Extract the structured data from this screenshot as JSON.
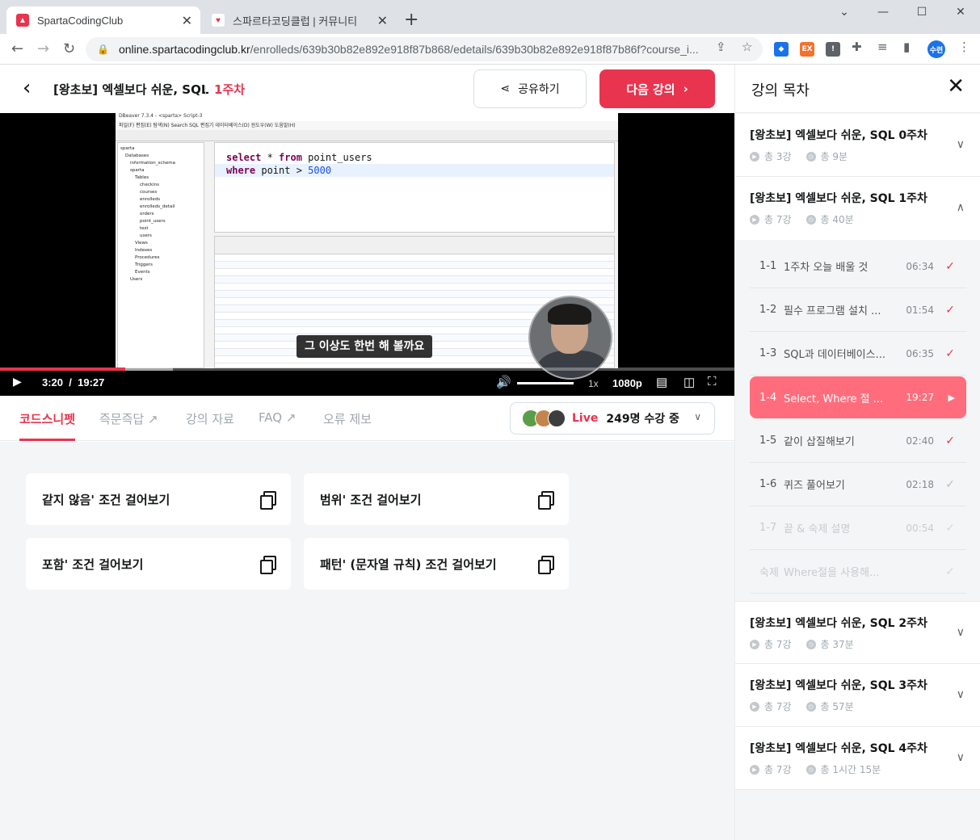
{
  "browser": {
    "tabs": [
      {
        "title": "SpartaCodingClub",
        "active": true
      },
      {
        "title": "스파르타코딩클럽 | 커뮤니티",
        "active": false
      }
    ],
    "url_host": "online.spartacodingclub.kr",
    "url_path": "/enrolleds/639b30b82e892e918f87b868/edetails/639b30b82e892e918f87b86f?course_i...",
    "profile_label": "수련"
  },
  "header": {
    "course_title": "[왕초보] 엑셀보다 쉬운, SQL",
    "week_label": "1주차",
    "share_label": "공유하기",
    "next_label": "다음 강의"
  },
  "video": {
    "sql_line1": [
      "select",
      " * ",
      "from",
      " point_users"
    ],
    "sql_line2": [
      "where",
      " point ",
      "> ",
      "5000"
    ],
    "caption": "그 이상도 한번 해 볼까요",
    "current_time": "3:20",
    "separator": "/",
    "duration": "19:27",
    "progress": 0.171,
    "buffered": 0.235,
    "speed": "1x",
    "quality": "1080p",
    "db_title": "DBeaver 7.3.4 - <sparta> Script-3",
    "db_menu": "파일(F)  편집(E)  탐색(N)  Search  SQL 편집기  데이터베이스(D)  윈도우(W)  도움말(H)",
    "db_tree": [
      "sparta",
      "Databases",
      "information_schema",
      "sparta",
      "Tables",
      "checkins",
      "courses",
      "enrolleds",
      "enrolleds_detail",
      "orders",
      "point_users",
      "test",
      "users",
      "Views",
      "Indexes",
      "Procedures",
      "Triggers",
      "Events",
      "Users"
    ]
  },
  "page_tabs": [
    {
      "label": "코드스니펫",
      "active": true
    },
    {
      "label": "즉문즉답",
      "active": false
    },
    {
      "label": "강의 자료",
      "active": false
    },
    {
      "label": "FAQ",
      "active": false
    },
    {
      "label": "오류 제보",
      "active": false
    }
  ],
  "live": {
    "tag": "Live",
    "count": "249명 수강 중"
  },
  "snippets": [
    "같지 않음' 조건 걸어보기",
    "범위' 조건 걸어보기",
    "포함' 조건 걸어보기",
    "패턴' (문자열 규칙) 조건 걸어보기"
  ],
  "sidebar": {
    "title": "강의 목차",
    "weeks": [
      {
        "title": "[왕초보] 엑셀보다 쉬운, SQL 0주차",
        "count": "총 3강",
        "time": "총 9분",
        "expanded": false
      },
      {
        "title": "[왕초보] 엑셀보다 쉬운, SQL 1주차",
        "count": "총 7강",
        "time": "총 40분",
        "expanded": true
      },
      {
        "title": "[왕초보] 엑셀보다 쉬운, SQL 2주차",
        "count": "총 7강",
        "time": "총 37분",
        "expanded": false
      },
      {
        "title": "[왕초보] 엑셀보다 쉬운, SQL 3주차",
        "count": "총 7강",
        "time": "총 57분",
        "expanded": false
      },
      {
        "title": "[왕초보] 엑셀보다 쉬운, SQL 4주차",
        "count": "총 7강",
        "time": "총 1시간 15분",
        "expanded": false
      }
    ],
    "lessons": [
      {
        "num": "1-1",
        "name": "1주차 오늘 배울 것",
        "duration": "06:34",
        "state": "done"
      },
      {
        "num": "1-2",
        "name": "필수 프로그램 설치 ...",
        "duration": "01:54",
        "state": "done"
      },
      {
        "num": "1-3",
        "name": "SQL과 데이터베이스...",
        "duration": "06:35",
        "state": "done"
      },
      {
        "num": "1-4",
        "name": "Select, Where 절 ...",
        "duration": "19:27",
        "state": "current"
      },
      {
        "num": "1-5",
        "name": "같이 삽질해보기",
        "duration": "02:40",
        "state": "done"
      },
      {
        "num": "1-6",
        "name": "퀴즈 풀어보기",
        "duration": "02:18",
        "state": "pending"
      },
      {
        "num": "1-7",
        "name": "끝 & 숙제 설명",
        "duration": "00:54",
        "state": "muted"
      },
      {
        "num": "숙제",
        "name": "Where절을 사용해...",
        "duration": "",
        "state": "muted"
      }
    ]
  },
  "colors": {
    "brand": "#e8344e",
    "current_lesson": "#ff6d7d"
  }
}
